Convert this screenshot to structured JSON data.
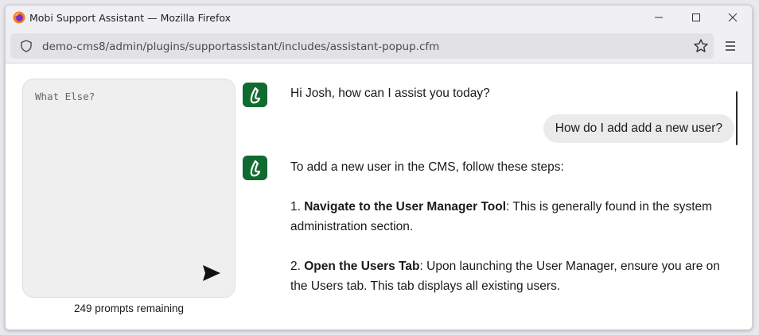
{
  "window": {
    "title": "Mobi Support Assistant — Mozilla Firefox",
    "url": "demo-cms8/admin/plugins/supportassistant/includes/assistant-popup.cfm"
  },
  "prompt": {
    "placeholder": "What Else?",
    "remaining": "249 prompts remaining"
  },
  "chat": {
    "greeting": "Hi Josh, how can I assist you today?",
    "user_message": "How do I add add a new user?",
    "reply_intro": "To add a new user in the CMS, follow these steps:",
    "steps": [
      {
        "num": "1. ",
        "title": "Navigate to the User Manager Tool",
        "text": ": This is generally found in the system administration section."
      },
      {
        "num": "2. ",
        "title": "Open the Users Tab",
        "text": ": Upon launching the User Manager, ensure you are on the Users tab. This tab displays all existing users."
      }
    ]
  },
  "colors": {
    "brand": "#0f6b2f"
  }
}
